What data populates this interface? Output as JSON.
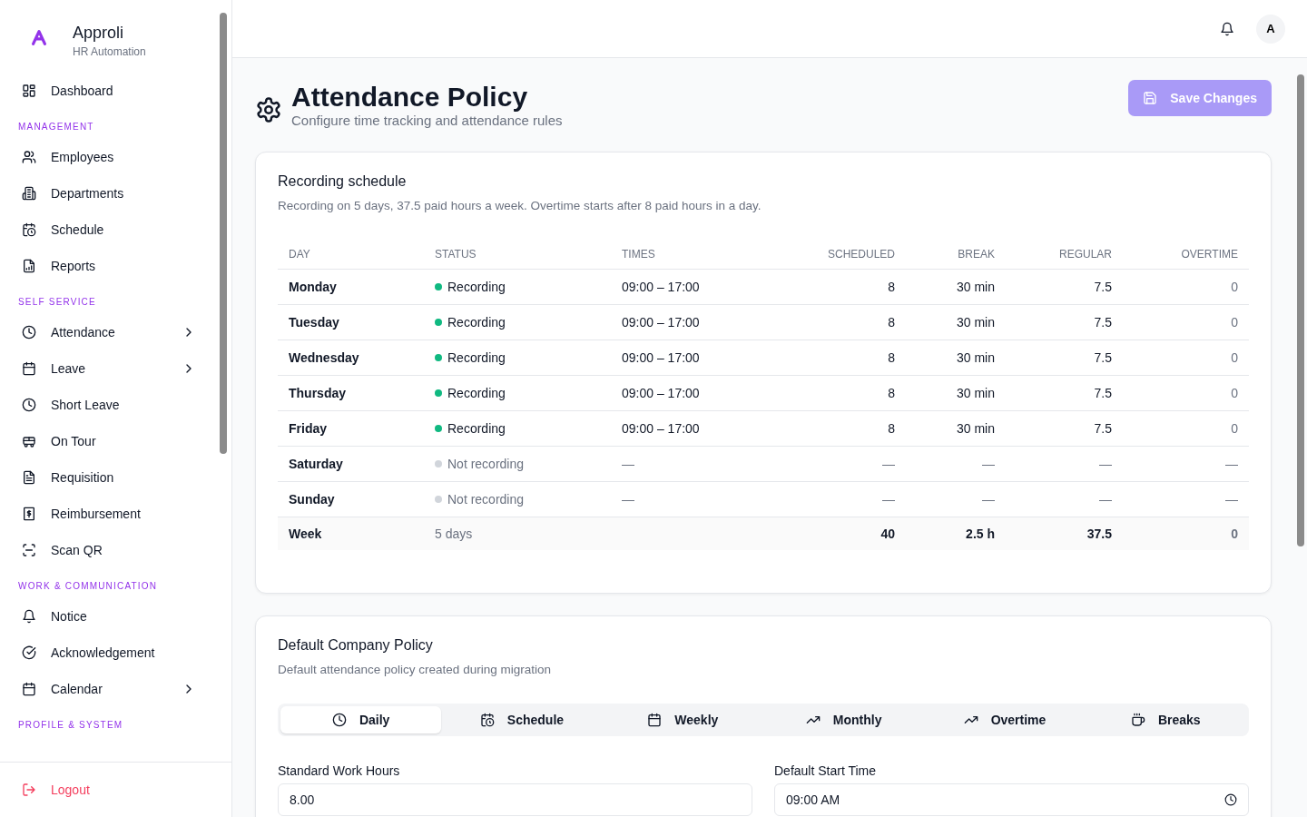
{
  "brand": {
    "name": "Approli",
    "subtitle": "HR Automation"
  },
  "sidebar": {
    "items": [
      {
        "label": "Dashboard",
        "selected": false,
        "expandable": false
      }
    ],
    "sections": [
      {
        "title": "MANAGEMENT",
        "items": [
          {
            "label": "Employees",
            "selected": false,
            "expandable": false
          },
          {
            "label": "Departments",
            "selected": false,
            "expandable": false
          },
          {
            "label": "Schedule",
            "selected": false,
            "expandable": false
          },
          {
            "label": "Reports",
            "selected": false,
            "expandable": false
          }
        ]
      },
      {
        "title": "SELF SERVICE",
        "items": [
          {
            "label": "Attendance",
            "selected": false,
            "expandable": true
          },
          {
            "label": "Leave",
            "selected": false,
            "expandable": true
          },
          {
            "label": "Short Leave",
            "selected": false,
            "expandable": false
          },
          {
            "label": "On Tour",
            "selected": false,
            "expandable": false
          },
          {
            "label": "Requisition",
            "selected": false,
            "expandable": false
          },
          {
            "label": "Reimbursement",
            "selected": false,
            "expandable": false
          },
          {
            "label": "Scan QR",
            "selected": false,
            "expandable": false
          }
        ]
      },
      {
        "title": "WORK & COMMUNICATION",
        "items": [
          {
            "label": "Notice",
            "selected": false,
            "expandable": false
          },
          {
            "label": "Acknowledgement",
            "selected": false,
            "expandable": false
          },
          {
            "label": "Calendar",
            "selected": false,
            "expandable": true
          }
        ]
      },
      {
        "title": "PROFILE & SYSTEM"
      }
    ],
    "logout": "Logout"
  },
  "header": {
    "avatar": "A"
  },
  "page": {
    "title": "Attendance Policy",
    "subtitle": "Configure time tracking and attendance rules",
    "save_button": {
      "label": "Save Changes",
      "disabled": true
    }
  },
  "schedule_card": {
    "title": "Recording schedule",
    "description": "Recording on 5 days, 37.5 paid hours a week. Overtime starts after 8 paid hours in a day.",
    "columns": [
      "DAY",
      "STATUS",
      "TIMES",
      "SCHEDULED",
      "BREAK",
      "REGULAR",
      "OVERTIME"
    ],
    "rows": [
      {
        "day": "Monday",
        "recording": true,
        "status": "Recording",
        "times": "09:00 – 17:00",
        "scheduled": "8",
        "break": "30 min",
        "regular": "7.5",
        "overtime": "0"
      },
      {
        "day": "Tuesday",
        "recording": true,
        "status": "Recording",
        "times": "09:00 – 17:00",
        "scheduled": "8",
        "break": "30 min",
        "regular": "7.5",
        "overtime": "0"
      },
      {
        "day": "Wednesday",
        "recording": true,
        "status": "Recording",
        "times": "09:00 – 17:00",
        "scheduled": "8",
        "break": "30 min",
        "regular": "7.5",
        "overtime": "0"
      },
      {
        "day": "Thursday",
        "recording": true,
        "status": "Recording",
        "times": "09:00 – 17:00",
        "scheduled": "8",
        "break": "30 min",
        "regular": "7.5",
        "overtime": "0"
      },
      {
        "day": "Friday",
        "recording": true,
        "status": "Recording",
        "times": "09:00 – 17:00",
        "scheduled": "8",
        "break": "30 min",
        "regular": "7.5",
        "overtime": "0"
      },
      {
        "day": "Saturday",
        "recording": false,
        "status": "Not recording",
        "times": "—",
        "scheduled": "—",
        "break": "—",
        "regular": "—",
        "overtime": "—"
      },
      {
        "day": "Sunday",
        "recording": false,
        "status": "Not recording",
        "times": "—",
        "scheduled": "—",
        "break": "—",
        "regular": "—",
        "overtime": "—"
      }
    ],
    "total": {
      "day": "Week",
      "status": "5 days",
      "scheduled": "40",
      "break": "2.5 h",
      "regular": "37.5",
      "overtime": "0"
    }
  },
  "policy_card": {
    "title": "Default Company Policy",
    "description": "Default attendance policy created during migration",
    "tabs": [
      {
        "label": "Daily",
        "selected": true
      },
      {
        "label": "Schedule",
        "selected": false
      },
      {
        "label": "Weekly",
        "selected": false
      },
      {
        "label": "Monthly",
        "selected": false
      },
      {
        "label": "Overtime",
        "selected": false
      },
      {
        "label": "Breaks",
        "selected": false
      }
    ],
    "fields": [
      {
        "label": "Standard Work Hours",
        "value": "8.00",
        "kind": "number"
      },
      {
        "label": "Default Start Time",
        "value": "09:00 AM",
        "kind": "time"
      }
    ]
  }
}
